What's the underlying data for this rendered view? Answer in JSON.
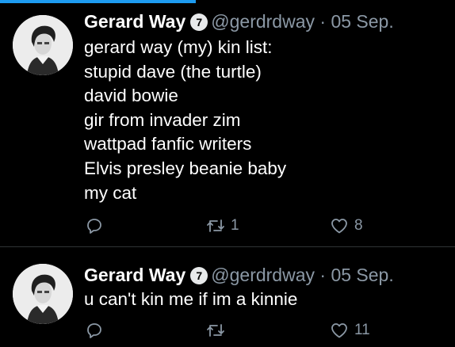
{
  "colors": {
    "background": "#000000",
    "text": "#ffffff",
    "secondary_text": "#8b98a5",
    "divider": "#2f3336",
    "progress": "#1d9bf0"
  },
  "progress": {
    "fraction": 0.43
  },
  "tweets": [
    {
      "name": "Gerard Way",
      "badge": "7",
      "handle": "@gerdrdway",
      "separator": "·",
      "date": "05 Sep.",
      "lines": [
        "gerard way (my) kin list:",
        "stupid dave (the turtle)",
        "david bowie",
        "gir from invader zim",
        "wattpad fanfic writers",
        "Elvis presley beanie baby",
        "my cat"
      ],
      "retweets": "1",
      "likes": "8",
      "icons": [
        "reply-icon",
        "retweet-icon",
        "like-icon"
      ]
    },
    {
      "name": "Gerard Way",
      "badge": "7",
      "handle": "@gerdrdway",
      "separator": "·",
      "date": "05 Sep.",
      "lines": [
        "u can't kin me if im a kinnie"
      ],
      "likes": "11",
      "icons": [
        "reply-icon",
        "retweet-icon",
        "like-icon"
      ]
    }
  ]
}
